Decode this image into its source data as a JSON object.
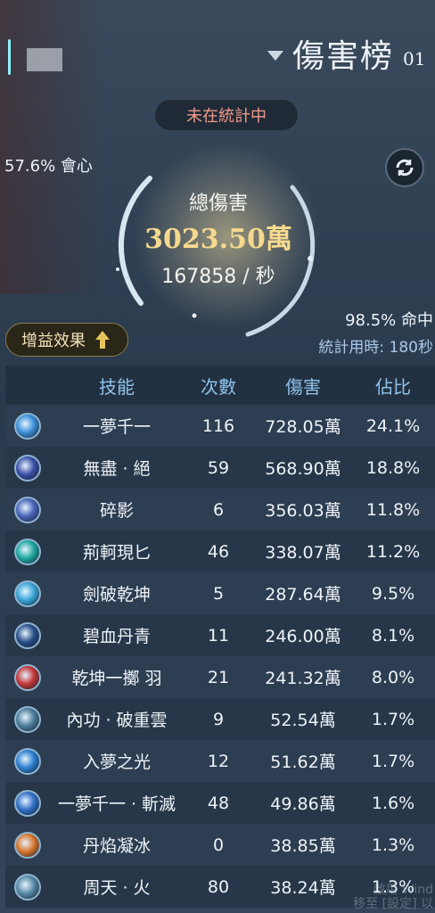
{
  "header": {
    "title": "傷害榜",
    "title_suffix": "01"
  },
  "status": {
    "label": "未在統計中"
  },
  "stats": {
    "crit": "57.6% 會心",
    "total_label": "總傷害",
    "total_value": "3023.50萬",
    "dps": "167858 / 秒",
    "hit": "98.5% 命中",
    "time": "統計用時: 180秒"
  },
  "buff_button": {
    "label": "增益效果"
  },
  "table": {
    "headers": {
      "skill": "技能",
      "count": "次數",
      "damage": "傷害",
      "pct": "佔比"
    },
    "rows": [
      {
        "name": "一夢千一",
        "count": "116",
        "damage": "728.05萬",
        "pct": "24.1%",
        "color": "#3b8fd6"
      },
      {
        "name": "無盡 · 絕",
        "count": "59",
        "damage": "568.90萬",
        "pct": "18.8%",
        "color": "#3d4fa8"
      },
      {
        "name": "碎影",
        "count": "6",
        "damage": "356.03萬",
        "pct": "11.8%",
        "color": "#4a63b8"
      },
      {
        "name": "荊軻現匕",
        "count": "46",
        "damage": "338.07萬",
        "pct": "11.2%",
        "color": "#1fa8a0"
      },
      {
        "name": "劍破乾坤",
        "count": "5",
        "damage": "287.64萬",
        "pct": "9.5%",
        "color": "#3aa6d8"
      },
      {
        "name": "碧血丹青",
        "count": "11",
        "damage": "246.00萬",
        "pct": "8.1%",
        "color": "#2a4f8a"
      },
      {
        "name": "乾坤一擲 羽",
        "count": "21",
        "damage": "241.32萬",
        "pct": "8.0%",
        "color": "#c43838"
      },
      {
        "name": "內功 · 破重雲",
        "count": "9",
        "damage": "52.54萬",
        "pct": "1.7%",
        "color": "#4e7d9a"
      },
      {
        "name": "入夢之光",
        "count": "12",
        "damage": "51.62萬",
        "pct": "1.7%",
        "color": "#2d7fd0"
      },
      {
        "name": "一夢千一 · 斬滅",
        "count": "48",
        "damage": "49.86萬",
        "pct": "1.6%",
        "color": "#3270c8"
      },
      {
        "name": "丹焰凝冰",
        "count": "0",
        "damage": "38.85萬",
        "pct": "1.3%",
        "color": "#d8782e"
      },
      {
        "name": "周天 · 火",
        "count": "80",
        "damage": "38.24萬",
        "pct": "1.3%",
        "color": "#5a8aa6"
      }
    ]
  },
  "watermark": {
    "line1": "啟用 Wind",
    "line2": "移至 [設定] 以"
  }
}
